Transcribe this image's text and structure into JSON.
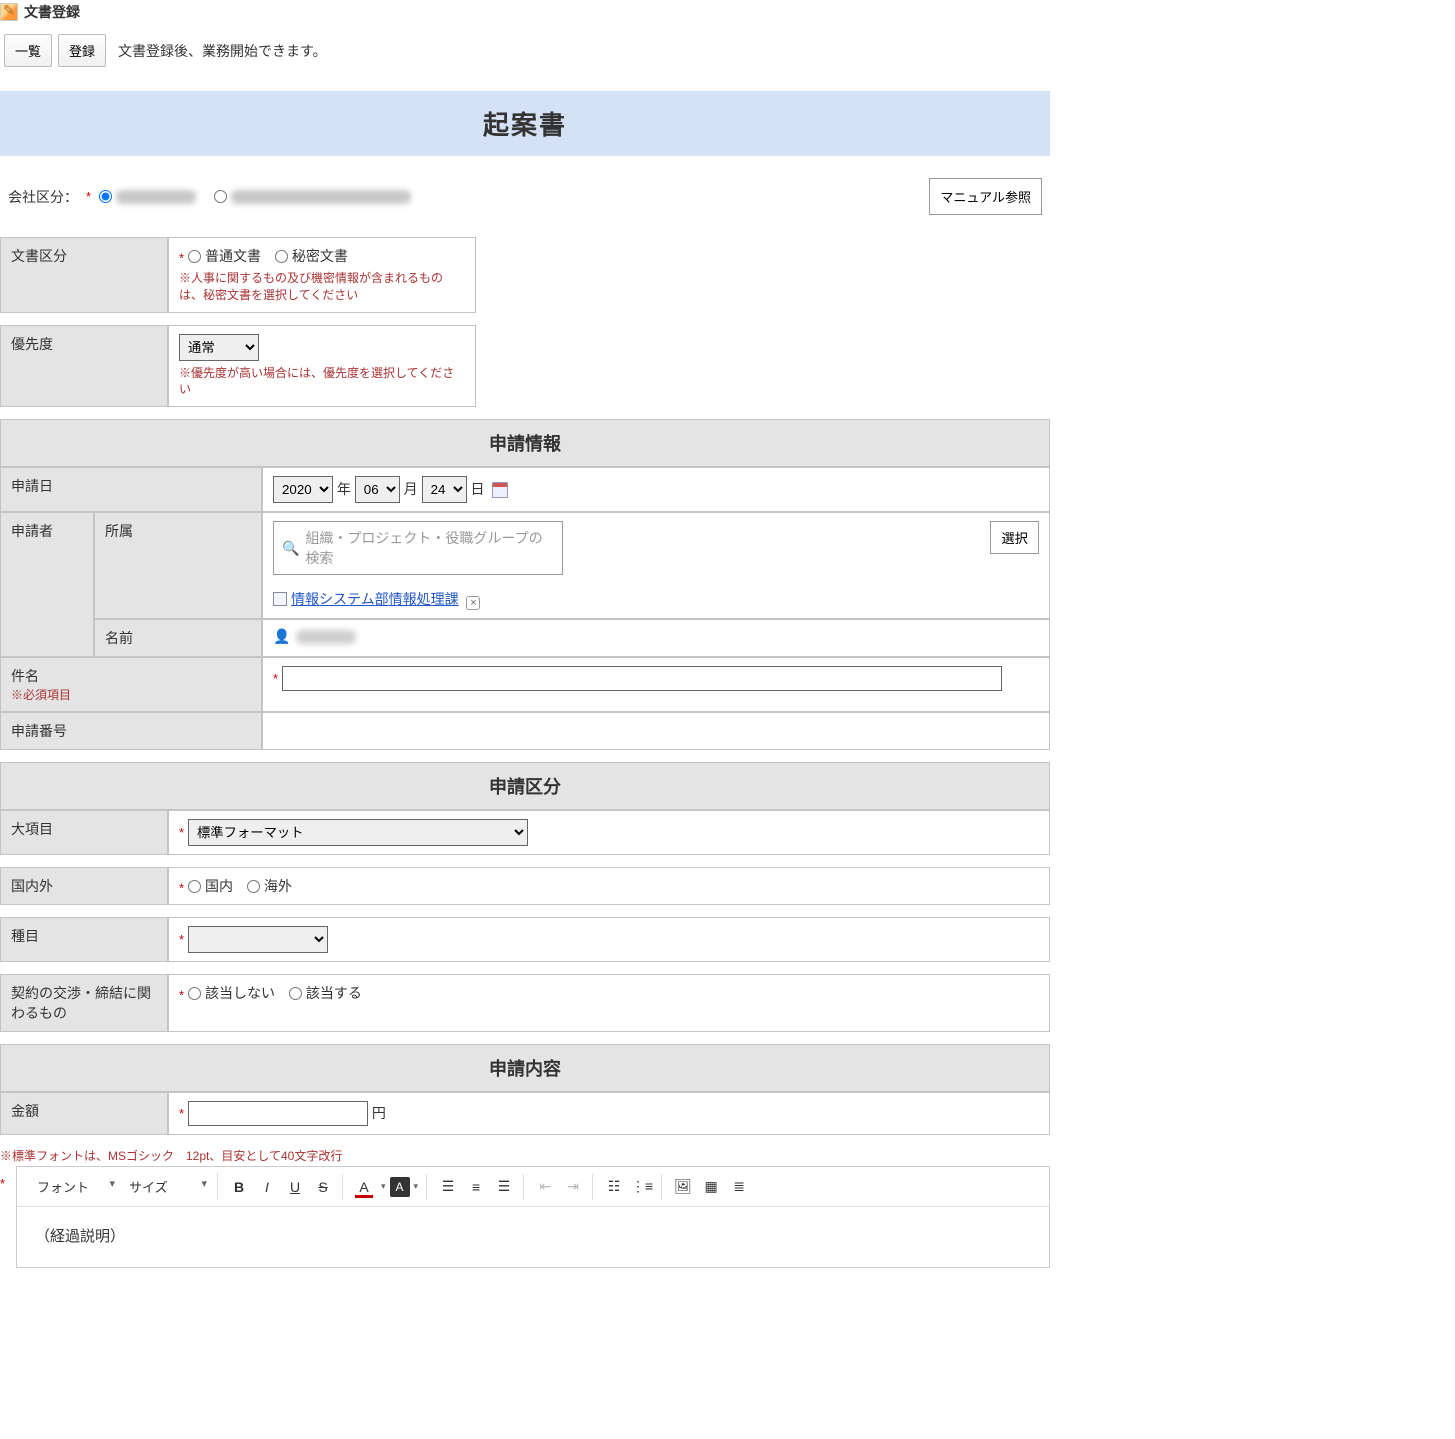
{
  "header": {
    "title": "文書登録"
  },
  "toolbar": {
    "list_label": "一覧",
    "register_label": "登録",
    "hint": "文書登録後、業務開始できます。"
  },
  "doc_title": "起案書",
  "company": {
    "label": "会社区分：",
    "manual_btn": "マニュアル参照"
  },
  "doc_type": {
    "label": "文書区分",
    "opt_normal": "普通文書",
    "opt_secret": "秘密文書",
    "note": "※人事に関するもの及び機密情報が含まれるものは、秘密文書を選択してください"
  },
  "priority": {
    "label": "優先度",
    "selected": "通常",
    "note": "※優先度が高い場合には、優先度を選択してください"
  },
  "apply_info": {
    "heading": "申請情報",
    "date_label": "申請日",
    "year": "2020",
    "month": "06",
    "day": "24",
    "year_suffix": "年",
    "month_suffix": "月",
    "day_suffix": "日",
    "applicant_label": "申請者",
    "dept_label": "所属",
    "name_label": "名前",
    "search_placeholder": "組織・プロジェクト・役職グループの検索",
    "dept_link": "情報システム部情報処理課",
    "select_btn": "選択",
    "subject_label": "件名",
    "subject_req_note": "※必須項目",
    "app_no_label": "申請番号"
  },
  "apply_cat": {
    "heading": "申請区分",
    "major_label": "大項目",
    "major_selected": "標準フォーマット",
    "domestic_label": "国内外",
    "opt_domestic": "国内",
    "opt_overseas": "海外",
    "kind_label": "種目",
    "contract_label": "契約の交渉・締結に関わるもの",
    "opt_not_apply": "該当しない",
    "opt_apply": "該当する"
  },
  "apply_content": {
    "heading": "申請内容",
    "amount_label": "金額",
    "amount_unit": "円",
    "font_note": "※標準フォントは、MSゴシック　12pt、目安として40文字改行",
    "editor_font_label": "フォント",
    "editor_size_label": "サイズ",
    "editor_body": "（経過説明）"
  }
}
